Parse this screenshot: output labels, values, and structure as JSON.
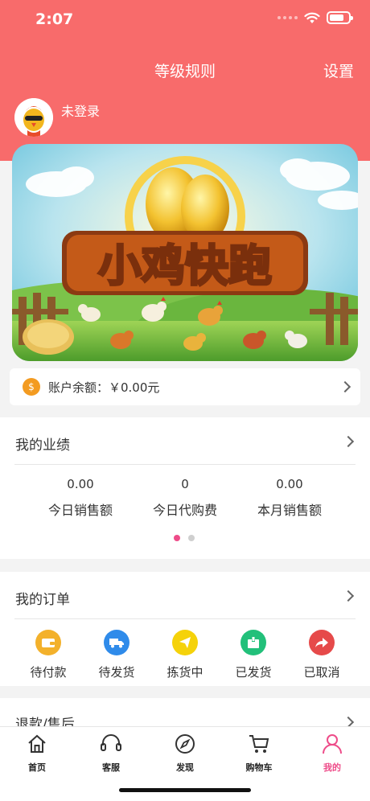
{
  "status_bar": {
    "time": "2:07"
  },
  "nav": {
    "title": "等级规则",
    "right": "设置"
  },
  "user": {
    "login_status": "未登录"
  },
  "banner": {
    "title": "小鸡快跑"
  },
  "balance": {
    "label": "账户余额：￥0.00元"
  },
  "performance": {
    "title": "我的业绩",
    "stats": [
      {
        "value": "0.00",
        "label": "今日销售额"
      },
      {
        "value": "0",
        "label": "今日代购费"
      },
      {
        "value": "0.00",
        "label": "本月销售额"
      }
    ]
  },
  "orders": {
    "title": "我的订单",
    "items": [
      {
        "label": "待付款",
        "icon": "wallet-icon",
        "color": "#f3b12b"
      },
      {
        "label": "待发货",
        "icon": "truck-icon",
        "color": "#2f8bea"
      },
      {
        "label": "拣货中",
        "icon": "paper-plane-icon",
        "color": "#f5d20a"
      },
      {
        "label": "已发货",
        "icon": "package-icon",
        "color": "#22c07a"
      },
      {
        "label": "已取消",
        "icon": "share-arrow-icon",
        "color": "#e64a4a"
      }
    ]
  },
  "after_sales": {
    "title": "退款/售后"
  },
  "tabbar": {
    "items": [
      {
        "label": "首页",
        "icon": "home-icon"
      },
      {
        "label": "客服",
        "icon": "headset-icon"
      },
      {
        "label": "发现",
        "icon": "compass-icon"
      },
      {
        "label": "购物车",
        "icon": "cart-icon"
      },
      {
        "label": "我的",
        "icon": "person-icon",
        "active": true
      }
    ]
  },
  "colors": {
    "header": "#f86b6b",
    "active_tab": "#ee4c89",
    "balance_coin": "#f39b21"
  }
}
